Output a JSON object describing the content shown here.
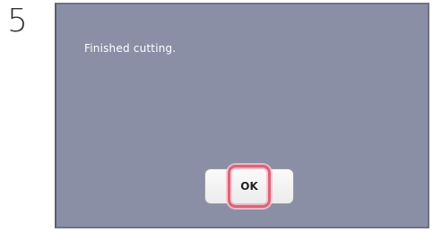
{
  "step": {
    "number": "5"
  },
  "dialog": {
    "message": "Finished cutting.",
    "ok_label": "OK"
  },
  "colors": {
    "screen_background": "#8a8fa6",
    "highlight": "#d9667a"
  }
}
